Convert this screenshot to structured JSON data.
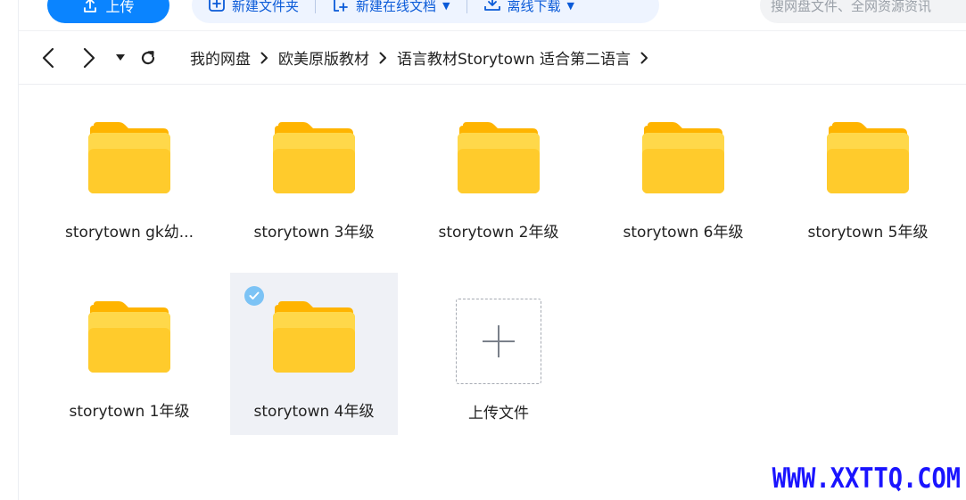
{
  "toolbar": {
    "upload_label": "上传",
    "new_folder_label": "新建文件夹",
    "new_online_doc_label": "新建在线文档",
    "offline_download_label": "离线下载",
    "search_placeholder": "搜网盘文件、全网资源资讯"
  },
  "breadcrumb": {
    "items": [
      "我的网盘",
      "欧美原版教材",
      "语言教材Storytown 适合第二语言"
    ]
  },
  "folders": [
    {
      "name": "storytown gk幼..."
    },
    {
      "name": "storytown 3年级"
    },
    {
      "name": "storytown 2年级"
    },
    {
      "name": "storytown 6年级"
    },
    {
      "name": "storytown 5年级"
    },
    {
      "name": "storytown 1年级"
    },
    {
      "name": "storytown 4年级",
      "selected": true
    }
  ],
  "upload_tile": {
    "label": "上传文件"
  },
  "watermark": {
    "text": "WWW.XXTTQ.COM"
  },
  "colors": {
    "accent": "#0a84ff",
    "folder_yellow": "#ffc928",
    "selected_bg": "#eff1f6",
    "watermark": "#1a14ff"
  }
}
